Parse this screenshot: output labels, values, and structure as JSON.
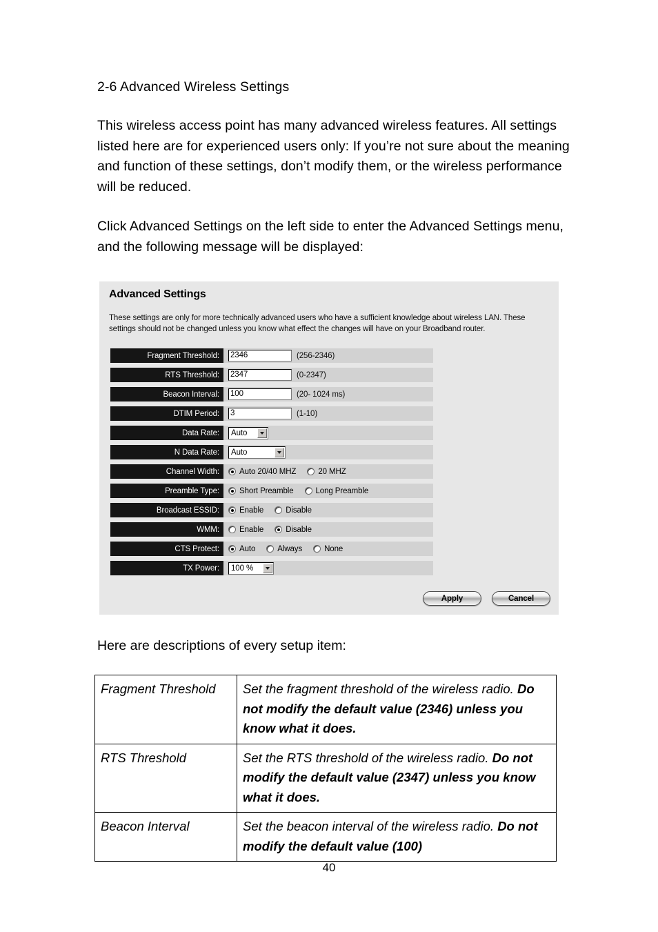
{
  "document": {
    "heading": "2-6 Advanced Wireless Settings",
    "paragraph1": "This wireless access point has many advanced wireless features. All settings listed here are for experienced users only: If you’re not sure about the meaning and function of these settings, don’t modify them, or the wireless performance will be reduced.",
    "paragraph2": "Click Advanced Settings on the left side to enter the Advanced Settings menu, and the following message will be displayed:",
    "caption": "Here are descriptions of every setup item:",
    "page_number": "40"
  },
  "panel": {
    "title": "Advanced Settings",
    "description": "These settings are only for more technically advanced users who have a sufficient knowledge about wireless LAN. These settings should not be changed unless you know what effect the changes will have on your Broadband router.",
    "colors": {
      "panel_background": "#e7e7e7",
      "row_label_background": "#151515",
      "row_value_background": "#d2d2d2",
      "row_label_text": "#ffffff"
    },
    "fields": {
      "fragment_threshold": {
        "label": "Fragment Threshold:",
        "value": "2346",
        "hint": "(256-2346)"
      },
      "rts_threshold": {
        "label": "RTS Threshold:",
        "value": "2347",
        "hint": "(0-2347)"
      },
      "beacon_interval": {
        "label": "Beacon Interval:",
        "value": "100",
        "hint": "(20- 1024 ms)"
      },
      "dtim_period": {
        "label": "DTIM Period:",
        "value": "3",
        "hint": "(1-10)"
      },
      "data_rate": {
        "label": "Data Rate:",
        "value": "Auto"
      },
      "n_data_rate": {
        "label": "N Data Rate:",
        "value": "Auto"
      },
      "channel_width": {
        "label": "Channel Width:",
        "options": [
          {
            "label": "Auto 20/40 MHZ",
            "selected": true
          },
          {
            "label": "20 MHZ",
            "selected": false
          }
        ]
      },
      "preamble_type": {
        "label": "Preamble Type:",
        "options": [
          {
            "label": "Short Preamble",
            "selected": true
          },
          {
            "label": "Long Preamble",
            "selected": false
          }
        ]
      },
      "broadcast_essid": {
        "label": "Broadcast ESSID:",
        "options": [
          {
            "label": "Enable",
            "selected": true
          },
          {
            "label": "Disable",
            "selected": false
          }
        ]
      },
      "wmm": {
        "label": "WMM:",
        "options": [
          {
            "label": "Enable",
            "selected": false
          },
          {
            "label": "Disable",
            "selected": true
          }
        ]
      },
      "cts_protect": {
        "label": "CTS Protect:",
        "options": [
          {
            "label": "Auto",
            "selected": true
          },
          {
            "label": "Always",
            "selected": false
          },
          {
            "label": "None",
            "selected": false
          }
        ]
      },
      "tx_power": {
        "label": "TX Power:",
        "value": "100 %"
      }
    },
    "buttons": {
      "apply": "Apply",
      "cancel": "Cancel"
    }
  },
  "description_table": {
    "rows": [
      {
        "term": "Fragment Threshold",
        "def_plain": "Set the fragment threshold of the wireless radio. ",
        "def_bold": "Do not modify the default value (2346) unless you know what it does."
      },
      {
        "term": "RTS Threshold",
        "def_plain": "Set the RTS threshold of the wireless radio. ",
        "def_bold": "Do not modify the default value (2347) unless you know what it does."
      },
      {
        "term": "Beacon Interval",
        "def_plain": "Set the beacon interval of the wireless radio. ",
        "def_bold": "Do not modify the default value (100)"
      }
    ]
  }
}
